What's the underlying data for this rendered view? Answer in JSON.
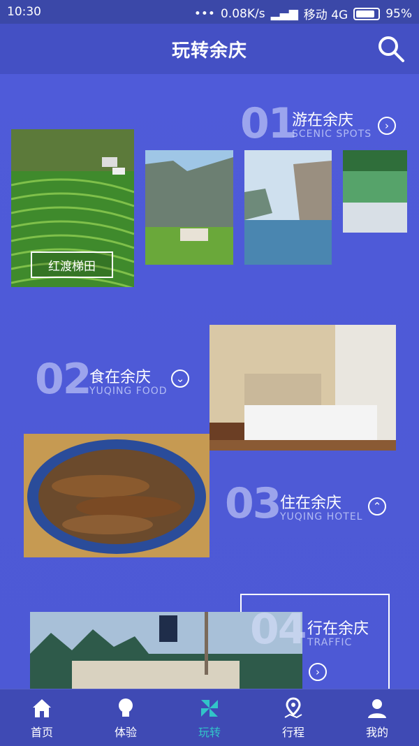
{
  "status": {
    "time": "10:30",
    "network": "0.08K/s",
    "carrier": "移动 4G",
    "battery": "95%"
  },
  "header": {
    "title": "玩转余庆"
  },
  "sections": {
    "s1": {
      "num": "01",
      "title": "游在余庆",
      "sub": "SCENIC SPOTS",
      "chip": "红渡梯田"
    },
    "s2": {
      "num": "02",
      "title": "食在余庆",
      "sub": "YUQING FOOD"
    },
    "s3": {
      "num": "03",
      "title": "住在余庆",
      "sub": "YUQING HOTEL"
    },
    "s4": {
      "num": "04",
      "title": "行在余庆",
      "sub": "TRAFFIC"
    }
  },
  "nav": [
    {
      "label": "首页",
      "icon": "home-icon"
    },
    {
      "label": "体验",
      "icon": "bulb-icon"
    },
    {
      "label": "玩转",
      "icon": "pinwheel-icon"
    },
    {
      "label": "行程",
      "icon": "route-icon"
    },
    {
      "label": "我的",
      "icon": "user-icon"
    }
  ],
  "colors": {
    "background": "#4e5ad8",
    "header": "#4450c4",
    "active": "#32c4c8"
  }
}
